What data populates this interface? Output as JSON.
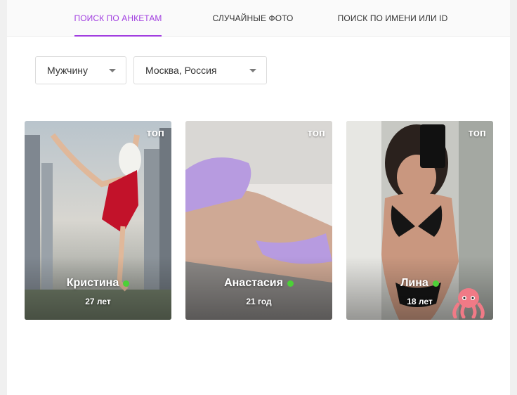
{
  "tabs": [
    {
      "label": "ПОИСК ПО АНКЕТАМ",
      "active": true
    },
    {
      "label": "СЛУЧАЙНЫЕ ФОТО",
      "active": false
    },
    {
      "label": "ПОИСК ПО ИМЕНИ ИЛИ ID",
      "active": false
    }
  ],
  "filters": {
    "gender": {
      "value": "Мужчину"
    },
    "city": {
      "value": "Москва, Россия"
    }
  },
  "colors": {
    "accent": "#a13ee0",
    "online": "#4cd137"
  },
  "profiles": [
    {
      "badge": "топ",
      "name": "Кристина",
      "age": "27 лет",
      "online": true
    },
    {
      "badge": "топ",
      "name": "Анастасия",
      "age": "21 год",
      "online": true
    },
    {
      "badge": "топ",
      "name": "Лина",
      "age": "18 лет",
      "online": true,
      "sticker": "octopus-emoji"
    }
  ]
}
